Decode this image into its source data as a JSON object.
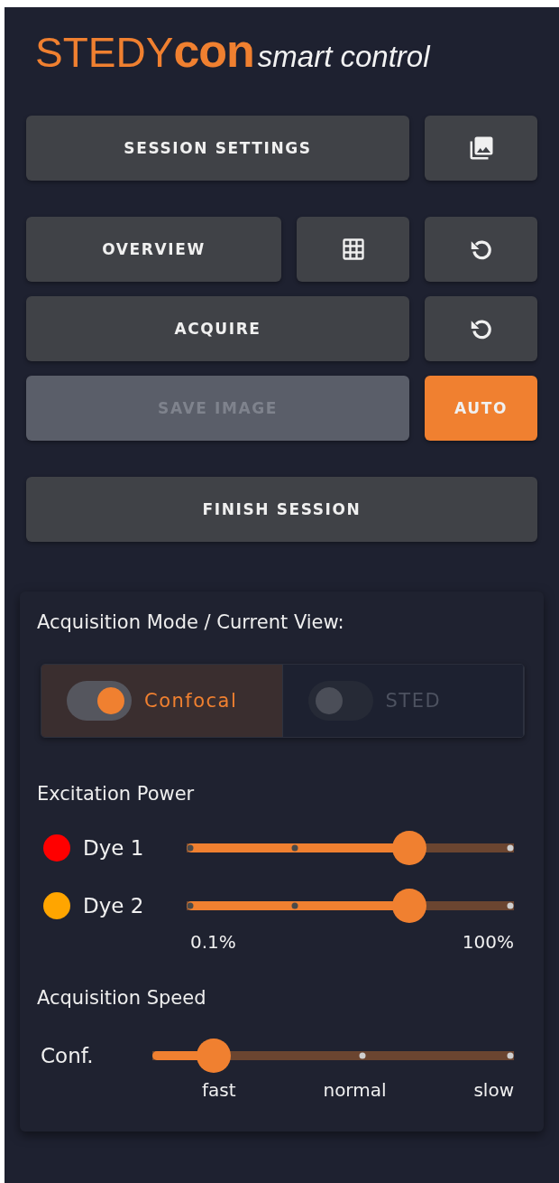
{
  "logo": {
    "brand": "STEDY**con**",
    "tagline": "smart control"
  },
  "button_rows": [
    [
      {
        "kind": "text",
        "label": "SESSION SETTINGS",
        "disabled": false,
        "on": false
      },
      {
        "kind": "gallery",
        "disabled": false,
        "on": false
      }
    ],
    [
      {
        "kind": "text",
        "label": "OVERVIEW",
        "disabled": false,
        "on": false
      },
      {
        "kind": "grid",
        "disabled": false,
        "on": false
      },
      {
        "kind": "refresh",
        "disabled": false,
        "on": false
      }
    ],
    [
      {
        "kind": "text",
        "label": "ACQUIRE",
        "disabled": false,
        "on": false
      },
      {
        "kind": "refresh",
        "disabled": false,
        "on": false
      }
    ],
    [
      {
        "kind": "text",
        "label": "SAVE IMAGE",
        "disabled": true,
        "on": false
      },
      {
        "kind": "text",
        "label": "AUTO",
        "disabled": false,
        "on": true
      }
    ],
    [
      {
        "kind": "text",
        "label": "FINISH SESSION",
        "disabled": false,
        "on": false
      }
    ]
  ],
  "panel": {
    "mode_title": "Acquisition Mode / Current View:",
    "modes": [
      {
        "label": "Confocal",
        "selected": true
      },
      {
        "label": "STED",
        "selected": false
      }
    ],
    "power_title": "Excitation Power",
    "dyes": [
      {
        "name": "Dye 1",
        "color": "#ff0000",
        "level": 0.68
      },
      {
        "name": "Dye 2",
        "color": "#ffa500",
        "level": 0.68
      }
    ],
    "power_min": "0.1%",
    "power_max": "100%",
    "speed_title": "Acquisition Speed",
    "speed": {
      "name": "Conf.",
      "level": 0.17,
      "labels": [
        "fast",
        "normal",
        "slow"
      ]
    }
  }
}
